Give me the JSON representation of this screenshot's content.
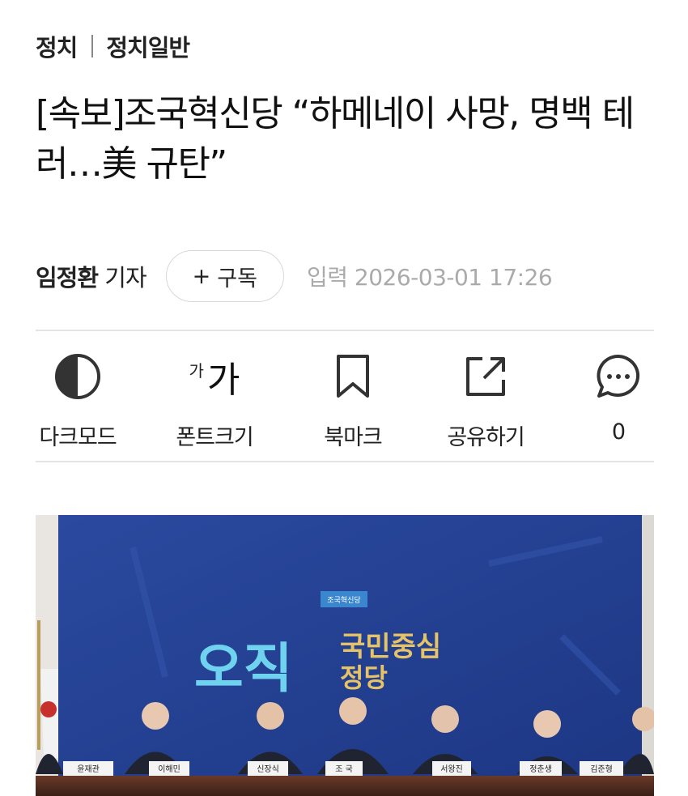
{
  "breadcrumb": {
    "section": "정치",
    "subsection": "정치일반"
  },
  "headline": "[속보]조국혁신당 “하메네이 사망, 명백 테러…美 규탄”",
  "byline": {
    "reporter_name": "임정환",
    "reporter_suffix": "기자",
    "subscribe_plus": "+",
    "subscribe_label": "구독",
    "date_label": "입력",
    "date_value": "2026-03-01 17:26"
  },
  "toolbar": [
    {
      "icon": "dark-mode-icon",
      "label": "다크모드"
    },
    {
      "icon": "font-size-icon",
      "label": "폰트크기",
      "icon_small": "가",
      "icon_large": "가"
    },
    {
      "icon": "bookmark-icon",
      "label": "북마크"
    },
    {
      "icon": "share-icon",
      "label": "공유하기"
    },
    {
      "icon": "comment-icon",
      "label": "0"
    }
  ],
  "photo": {
    "party_logo": "조국혁신당",
    "slogan_main": "오직",
    "slogan_top": "국민중심",
    "slogan_bottom": "정당",
    "nameplates": [
      "윤재관",
      "이해민",
      "신장식",
      "조 국",
      "서왕진",
      "정춘생",
      "김준형"
    ]
  },
  "colors": {
    "backdrop": "#24408f",
    "slogan_main": "#6fd3ef",
    "slogan_gold": "#e7c368"
  }
}
